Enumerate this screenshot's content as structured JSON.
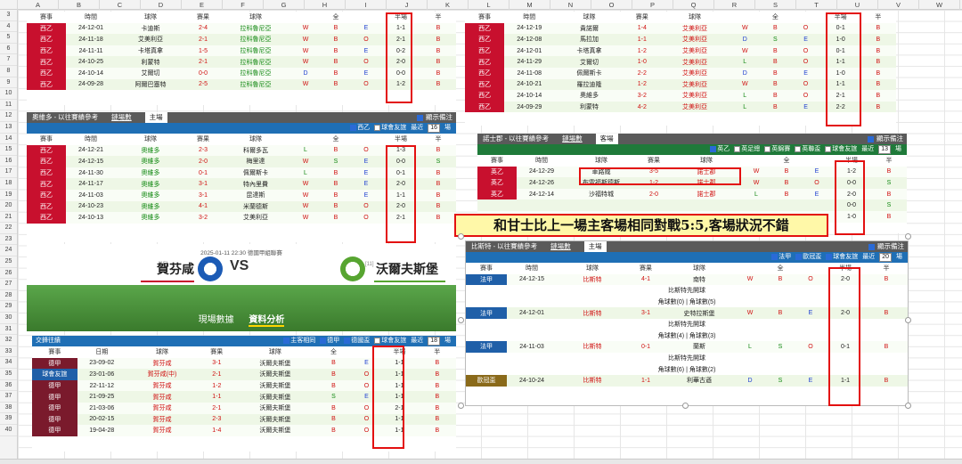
{
  "columns": [
    "A",
    "B",
    "C",
    "D",
    "E",
    "F",
    "G",
    "H",
    "I",
    "J",
    "K",
    "L",
    "M",
    "N",
    "O",
    "P",
    "Q",
    "R",
    "S",
    "T",
    "U",
    "V",
    "W"
  ],
  "rows": [
    "3",
    "4",
    "5",
    "6",
    "7",
    "8",
    "9",
    "10",
    "11",
    "12",
    "13",
    "14",
    "15",
    "16",
    "17",
    "18",
    "19",
    "20",
    "21",
    "22",
    "23",
    "24",
    "25",
    "26",
    "27",
    "28",
    "29",
    "30",
    "31",
    "32",
    "33",
    "34",
    "35",
    "36",
    "37",
    "38",
    "39",
    "40"
  ],
  "hdr": {
    "league": "賽事",
    "date": "時間",
    "team": "球隊",
    "score": "賽果",
    "full": "全",
    "half": "半場",
    "half_short": "半"
  },
  "p1": {
    "rows": [
      [
        "西乙",
        "24-12-01",
        "卡迪斯",
        "2-4",
        "拉科魯尼亞",
        "W",
        "B",
        "E",
        "1-1",
        "B"
      ],
      [
        "西乙",
        "24-11-18",
        "艾美利亞",
        "2-1",
        "拉科魯尼亞",
        "W",
        "B",
        "O",
        "2-1",
        "B"
      ],
      [
        "西乙",
        "24-11-11",
        "卡塔真拿",
        "1-5",
        "拉科魯尼亞",
        "W",
        "B",
        "E",
        "0-2",
        "B"
      ],
      [
        "西乙",
        "24-10-25",
        "利蒙特",
        "2-1",
        "拉科魯尼亞",
        "W",
        "B",
        "O",
        "2-0",
        "B"
      ],
      [
        "西乙",
        "24-10-14",
        "艾爾切",
        "0-0",
        "拉科魯尼亞",
        "D",
        "B",
        "E",
        "0-0",
        "B"
      ],
      [
        "西乙",
        "24-09-28",
        "阿爾巴塞特",
        "2-5",
        "拉科魯尼亞",
        "W",
        "B",
        "O",
        "1-2",
        "B"
      ]
    ]
  },
  "p2": {
    "title": "奧維多 - 以往賽績參考",
    "tab1": "鏈場數",
    "tab2": "主場",
    "note": "顯示備注",
    "league_filter": "西乙",
    "cup_filter": "球會友誼",
    "recent": "最近",
    "recent_n": "16",
    "unit": "場",
    "rows": [
      [
        "西乙",
        "24-12-21",
        "奧維多",
        "2-3",
        "科爾多瓦",
        "L",
        "B",
        "O",
        "1-3",
        "B"
      ],
      [
        "西乙",
        "24-12-15",
        "奧維多",
        "2-0",
        "梅里達",
        "W",
        "S",
        "E",
        "0-0",
        "S"
      ],
      [
        "西乙",
        "24-11-30",
        "奧維多",
        "0-1",
        "佩爾斯卡",
        "L",
        "B",
        "E",
        "0-1",
        "B"
      ],
      [
        "西乙",
        "24-11-17",
        "奧維多",
        "3-1",
        "特內里費",
        "W",
        "B",
        "E",
        "2-0",
        "B"
      ],
      [
        "西乙",
        "24-11-03",
        "奧維多",
        "3-1",
        "昆達斯",
        "W",
        "B",
        "E",
        "1-1",
        "B"
      ],
      [
        "西乙",
        "24-10-23",
        "奧維多",
        "4-1",
        "米蘭德斯",
        "W",
        "B",
        "O",
        "2-0",
        "B"
      ],
      [
        "西乙",
        "24-10-13",
        "奧維多",
        "3-2",
        "艾美利亞",
        "W",
        "B",
        "O",
        "2-1",
        "B"
      ]
    ]
  },
  "p3": {
    "rows": [
      [
        "西乙",
        "24-12-19",
        "貴諾爾",
        "1-4",
        "艾美利亞",
        "W",
        "B",
        "O",
        "0-1",
        "B"
      ],
      [
        "西乙",
        "24-12-08",
        "馬拉加",
        "1-1",
        "艾美利亞",
        "D",
        "S",
        "E",
        "1-0",
        "B"
      ],
      [
        "西乙",
        "24-12-01",
        "卡塔真拿",
        "1-2",
        "艾美利亞",
        "W",
        "B",
        "O",
        "0-1",
        "B"
      ],
      [
        "西乙",
        "24-11-29",
        "艾爾切",
        "1-0",
        "艾美利亞",
        "L",
        "B",
        "O",
        "1-1",
        "B"
      ],
      [
        "西乙",
        "24-11-08",
        "佩爾斯卡",
        "2-2",
        "艾美利亞",
        "D",
        "B",
        "E",
        "1-0",
        "B"
      ],
      [
        "西乙",
        "24-10-21",
        "羅拉迪隆",
        "1-2",
        "艾美利亞",
        "W",
        "B",
        "O",
        "1-1",
        "B"
      ],
      [
        "西乙",
        "24-10-14",
        "奧維多",
        "3-2",
        "艾美利亞",
        "L",
        "B",
        "O",
        "2-1",
        "B"
      ],
      [
        "西乙",
        "24-09-29",
        "利蒙特",
        "4-2",
        "艾美利亞",
        "L",
        "B",
        "E",
        "2-2",
        "B"
      ]
    ]
  },
  "p4": {
    "title": "諾士郡 - 以往賽績參考",
    "tab1": "鏈場數",
    "tab2": "客場",
    "note": "顯示備注",
    "filters": [
      "英乙",
      "英足總",
      "英錦賽",
      "英聯盃",
      "球會友誼"
    ],
    "recent": "最近",
    "recent_n": "13",
    "unit": "場",
    "rows": [
      [
        "英乙",
        "24-12-29",
        "車路威",
        "3-5",
        "諾士郡",
        "W",
        "B",
        "E",
        "1-2",
        "B"
      ],
      [
        "英乙",
        "24-12-26",
        "布雷福斯德斯",
        "1-2",
        "諾士郡",
        "W",
        "B",
        "O",
        "0-0",
        "S"
      ],
      [
        "英乙",
        "24-12-14",
        "沙福特城",
        "2-0",
        "諾士郡",
        "L",
        "B",
        "E",
        "2-0",
        "B"
      ],
      [
        "",
        "",
        "",
        "",
        "",
        "",
        "",
        "",
        "0-0",
        "S"
      ],
      [
        "",
        "",
        "",
        "",
        "",
        "",
        "",
        "",
        "1-0",
        "B"
      ]
    ]
  },
  "annotation": "和甘士比上一場主客場相同對戰5:5,客場狀況不錯",
  "p5": {
    "title": "比斯特 - 以往賽績參考",
    "tab1": "鏈場數",
    "tab2": "主場",
    "note": "顯示備注",
    "filters": [
      "法甲",
      "歐冠盃",
      "球會友誼"
    ],
    "recent": "最近",
    "recent_n": "20",
    "unit": "場",
    "rows": [
      {
        "league": "法甲",
        "date": "24-12-15",
        "home": "比斯特",
        "score": "4-1",
        "away": "南特",
        "wl": "W",
        "ou": "B",
        "oe": "O",
        "half": "2-0",
        "h": "B",
        "notes": [
          "比斯特先開球",
          "角球數(0) | 角球數(5)"
        ]
      },
      {
        "league": "法甲",
        "date": "24-12-01",
        "home": "比斯特",
        "score": "3-1",
        "away": "史特拉斯堡",
        "wl": "W",
        "ou": "B",
        "oe": "E",
        "half": "2-0",
        "h": "B",
        "notes": [
          "比斯特先開球",
          "角球數(4) | 角球數(3)"
        ]
      },
      {
        "league": "法甲",
        "date": "24-11-03",
        "home": "比斯特",
        "score": "0-1",
        "away": "蘭斯",
        "wl": "L",
        "ou": "S",
        "oe": "O",
        "half": "0-1",
        "h": "B",
        "notes": [
          "比斯特先開球",
          "角球數(6) | 角球數(2)"
        ]
      },
      {
        "league": "歐冠盃",
        "date": "24-10-24",
        "home": "比斯特",
        "score": "1-1",
        "away": "利華古遜",
        "wl": "D",
        "ou": "S",
        "oe": "E",
        "half": "1-1",
        "h": "B",
        "notes": []
      }
    ]
  },
  "hero": {
    "info": "2025-01-11 22:30    德國甲組聯賽",
    "home": "賀芬咸",
    "away": "沃爾夫斯堡",
    "vs": "VS",
    "home_rank": "[15]",
    "away_rank": "[11]",
    "tab1": "現場數據",
    "tab2": "資料分析"
  },
  "p6": {
    "title": "交鋒往績",
    "filters": [
      "主客相同",
      "德甲",
      "德國盃",
      "球會友誼"
    ],
    "recent": "最近",
    "recent_n": "18",
    "unit": "場",
    "rows": [
      [
        "德甲",
        "23-09-02",
        "賀芬咸",
        "3-1",
        "沃爾夫斯堡",
        "B",
        "E",
        "1-1",
        "B"
      ],
      [
        "球會友誼",
        "23-01-06",
        "賀芬咸(中)",
        "2-1",
        "沃爾夫斯堡",
        "B",
        "O",
        "1-1",
        "B"
      ],
      [
        "德甲",
        "22-11-12",
        "賀芬咸",
        "1-2",
        "沃爾夫斯堡",
        "B",
        "O",
        "1-1",
        "B"
      ],
      [
        "德甲",
        "21-09-25",
        "賀芬咸",
        "1-1",
        "沃爾夫斯堡",
        "S",
        "E",
        "1-1",
        "B"
      ],
      [
        "德甲",
        "21-03-06",
        "賀芬咸",
        "2-1",
        "沃爾夫斯堡",
        "B",
        "O",
        "2-1",
        "B"
      ],
      [
        "德甲",
        "20-02-15",
        "賀芬咸",
        "2-3",
        "沃爾夫斯堡",
        "B",
        "O",
        "1-1",
        "B"
      ],
      [
        "德甲",
        "19-04-28",
        "賀芬咸",
        "1-4",
        "沃爾夫斯堡",
        "B",
        "O",
        "1-1",
        "B"
      ]
    ]
  },
  "colors": {
    "red": "#c8102e",
    "box": "#e31010",
    "blue": "#1f6fb5",
    "green": "#3a7a2c"
  }
}
